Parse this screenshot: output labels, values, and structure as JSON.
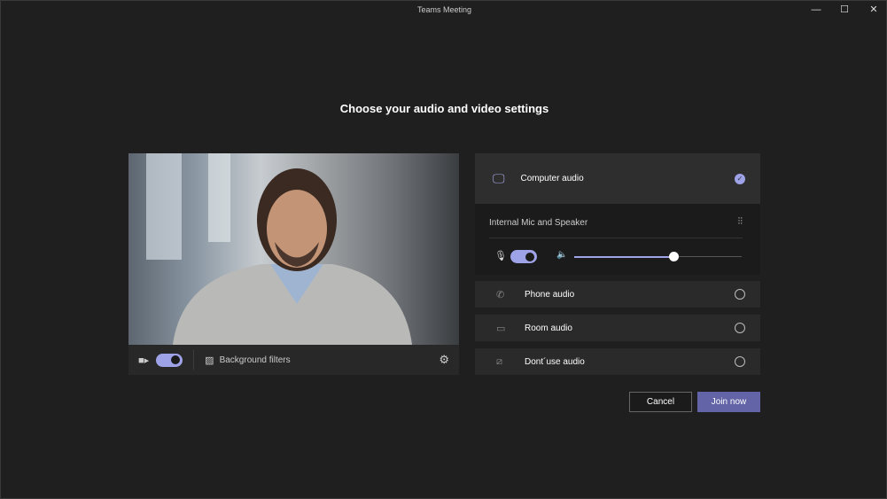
{
  "window": {
    "title": "Teams Meeting",
    "minimize": "—",
    "maximize": "☐",
    "close": "✕"
  },
  "heading": "Choose your audio and video settings",
  "video_bar": {
    "camera_on": true,
    "background_filters": "Background filters"
  },
  "audio": {
    "computer_audio": {
      "label": "Computer audio",
      "selected": true,
      "device": "Internal Mic and Speaker",
      "mic_on": true,
      "speaker_volume_percent": 59
    },
    "options": [
      {
        "label": "Phone audio",
        "icon": "phone-icon"
      },
      {
        "label": "Room audio",
        "icon": "monitor-icon"
      },
      {
        "label": "Dont´use audio",
        "icon": "no-audio-icon"
      }
    ]
  },
  "buttons": {
    "cancel": "Cancel",
    "join": "Join now"
  },
  "colors": {
    "accent": "#6264a7",
    "toggle": "#9ea2e6"
  }
}
